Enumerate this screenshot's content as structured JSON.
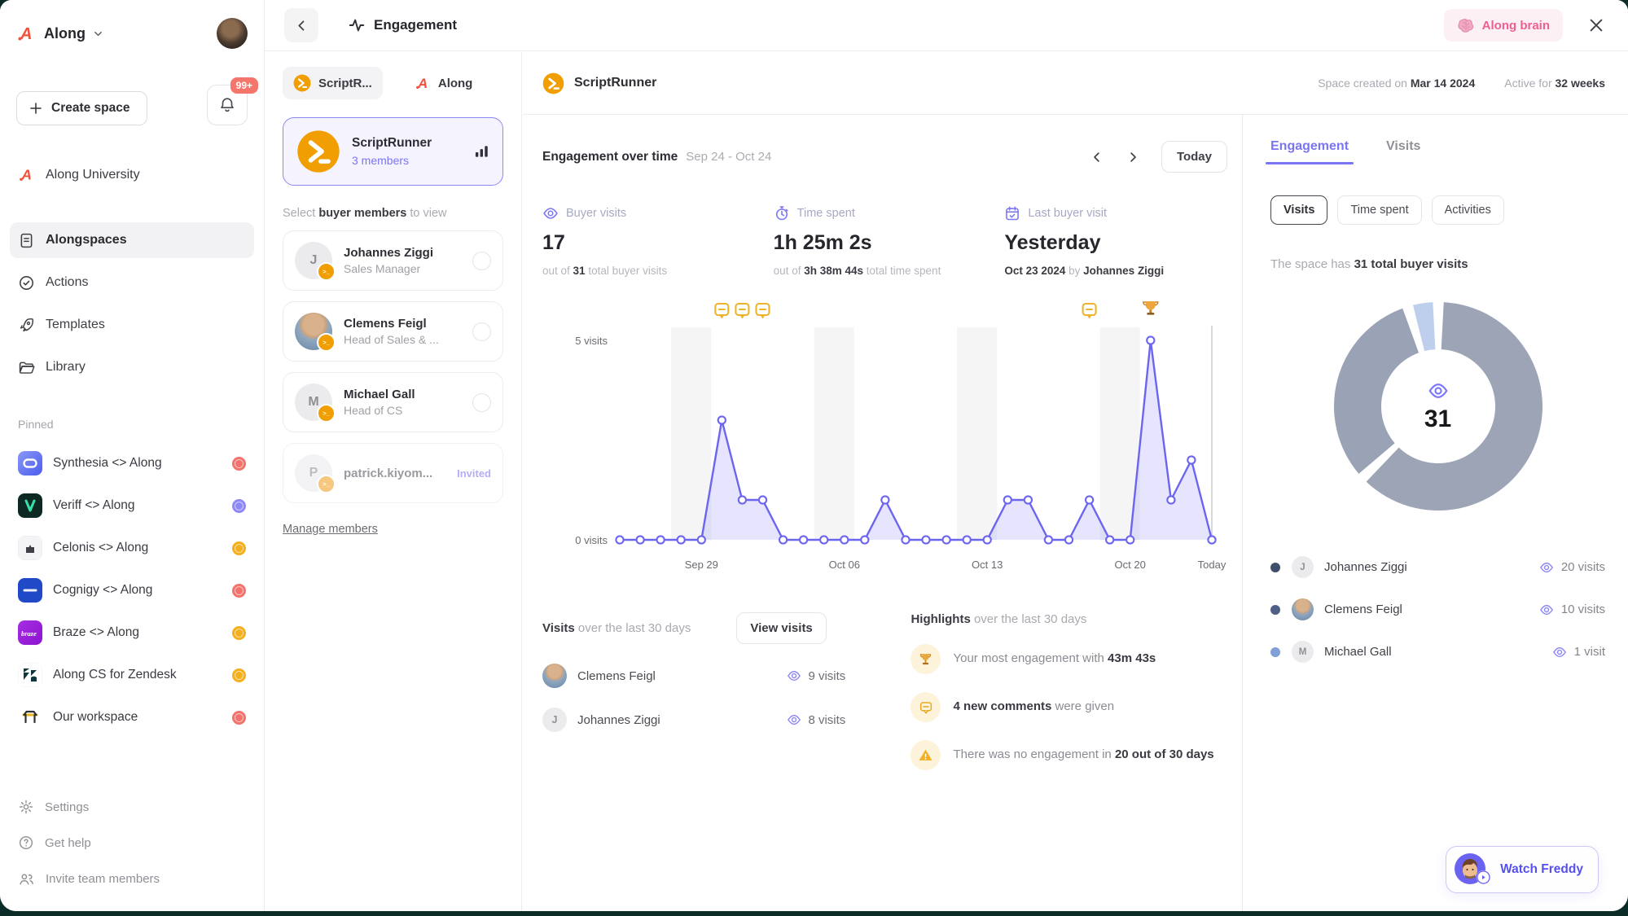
{
  "colors": {
    "accent_purple": "#7b74f3",
    "chart_line": "#6b65ef",
    "brand_red": "#f4503a",
    "orange": "#f19e02",
    "pink": "#ee5f93",
    "yellow": "#f3b01c"
  },
  "sidebar": {
    "workspace_name": "Along",
    "create_space_label": "Create space",
    "notification_badge": "99+",
    "university_label": "Along University",
    "nav_items": [
      {
        "label": "Alongspaces",
        "icon": "doc",
        "active": true
      },
      {
        "label": "Actions",
        "icon": "check-circle",
        "active": false
      },
      {
        "label": "Templates",
        "icon": "rocket",
        "active": false
      },
      {
        "label": "Library",
        "icon": "folder",
        "active": false
      }
    ],
    "pinned_label": "Pinned",
    "pinned_items": [
      {
        "label": "Synthesia <> Along",
        "icon": "synthesia",
        "status": "red"
      },
      {
        "label": "Veriff <> Along",
        "icon": "veriff",
        "status": "purple"
      },
      {
        "label": "Celonis <> Along",
        "icon": "celonis",
        "status": "yellow"
      },
      {
        "label": "Cognigy <> Along",
        "icon": "cognigy",
        "status": "red"
      },
      {
        "label": "Braze <> Along",
        "icon": "braze",
        "status": "yellow"
      },
      {
        "label": "Along CS for Zendesk",
        "icon": "zendesk",
        "status": "yellow"
      },
      {
        "label": "Our workspace",
        "icon": "workspace",
        "status": "red"
      }
    ],
    "footer_items": [
      {
        "label": "Settings",
        "icon": "gear"
      },
      {
        "label": "Get help",
        "icon": "help"
      },
      {
        "label": "Invite team members",
        "icon": "users"
      }
    ]
  },
  "topbar": {
    "title": "Engagement",
    "brain_button": "Along brain"
  },
  "space_panel": {
    "tabs": [
      {
        "label": "ScriptR...",
        "active": true
      },
      {
        "label": "Along",
        "active": false
      }
    ],
    "space_card": {
      "name": "ScriptRunner",
      "members": "3 members"
    },
    "select_hint": [
      {
        "t": "g",
        "s": "Select "
      },
      {
        "t": "b",
        "s": "buyer members"
      },
      {
        "t": "g",
        "s": " to view"
      }
    ],
    "members": [
      {
        "name": "Johannes Ziggi",
        "role": "Sales Manager",
        "avatar": "J",
        "invited": false
      },
      {
        "name": "Clemens Feigl",
        "role": "Head of Sales & ...",
        "avatar": "photo",
        "invited": false
      },
      {
        "name": "Michael Gall",
        "role": "Head of CS",
        "avatar": "M",
        "invited": false
      },
      {
        "name": "patrick.kiyom...",
        "role": "",
        "avatar": "P",
        "invited": true,
        "invited_label": "Invited"
      }
    ],
    "manage_link": "Manage members"
  },
  "main": {
    "space_name": "ScriptRunner",
    "created": [
      {
        "t": "g",
        "s": "Space created on "
      },
      {
        "t": "b",
        "s": "Mar 14 2024"
      }
    ],
    "active": [
      {
        "t": "g",
        "s": "Active for "
      },
      {
        "t": "b",
        "s": "32 weeks"
      }
    ],
    "section_title": "Engagement over time",
    "date_range": "Sep 24 - Oct 24",
    "today_button": "Today",
    "kpis": [
      {
        "icon": "eye",
        "label": "Buyer visits",
        "value": "17",
        "sub": [
          {
            "t": "g",
            "s": "out of "
          },
          {
            "t": "b",
            "s": "31"
          },
          {
            "t": "g",
            "s": " total buyer visits"
          }
        ]
      },
      {
        "icon": "stopwatch",
        "label": "Time spent",
        "value": "1h 25m 2s",
        "sub": [
          {
            "t": "g",
            "s": "out of "
          },
          {
            "t": "b",
            "s": "3h 38m 44s"
          },
          {
            "t": "g",
            "s": " total time spent"
          }
        ]
      },
      {
        "icon": "calendar",
        "label": "Last buyer visit",
        "value": "Yesterday",
        "sub": [
          {
            "t": "b",
            "s": "Oct 23 2024"
          },
          {
            "t": "g",
            "s": " by "
          },
          {
            "t": "b",
            "s": "Johannes Ziggi"
          }
        ]
      }
    ],
    "visits_section": {
      "title": [
        {
          "t": "b",
          "s": "Visits"
        },
        {
          "t": "g",
          "s": " over the last 30 days"
        }
      ],
      "button": "View visits",
      "rows": [
        {
          "name": "Clemens Feigl",
          "avatar": "photo",
          "count": "9 visits"
        },
        {
          "name": "Johannes Ziggi",
          "avatar": "J",
          "count": "8 visits"
        }
      ]
    },
    "highlights_section": {
      "title": [
        {
          "t": "b",
          "s": "Highlights"
        },
        {
          "t": "g",
          "s": " over the last 30 days"
        }
      ],
      "rows": [
        {
          "icon": "trophy",
          "text": [
            {
              "t": "g",
              "s": "Your most engagement with "
            },
            {
              "t": "b",
              "s": "43m 43s"
            }
          ]
        },
        {
          "icon": "comment",
          "text": [
            {
              "t": "b",
              "s": "4 new comments"
            },
            {
              "t": "g",
              "s": " were given"
            }
          ]
        },
        {
          "icon": "warning",
          "text": [
            {
              "t": "g",
              "s": "There was no engagement in "
            },
            {
              "t": "b",
              "s": "20 out of 30 days"
            }
          ]
        }
      ]
    }
  },
  "right_panel": {
    "tabs": [
      {
        "label": "Engagement",
        "active": true
      },
      {
        "label": "Visits",
        "active": false
      }
    ],
    "pills": [
      {
        "label": "Visits",
        "active": true
      },
      {
        "label": "Time spent",
        "active": false
      },
      {
        "label": "Activities",
        "active": false
      }
    ],
    "summary": [
      {
        "t": "g",
        "s": "The space has "
      },
      {
        "t": "b",
        "s": "31 total buyer visits"
      }
    ],
    "donut_total": "31",
    "legend": [
      {
        "name": "Johannes Ziggi",
        "avatar": "J",
        "count": "20 visits",
        "dot": "#3f4e6b"
      },
      {
        "name": "Clemens Feigl",
        "avatar": "photo",
        "count": "10 visits",
        "dot": "#4f5f85"
      },
      {
        "name": "Michael Gall",
        "avatar": "M",
        "count": "1 visit",
        "dot": "#81a0d8"
      }
    ],
    "watch_button": "Watch Freddy"
  },
  "chart_data": [
    {
      "type": "area",
      "title": "Engagement over time",
      "x": [
        "Sep 25",
        "Sep 26",
        "Sep 27",
        "Sep 28",
        "Sep 29",
        "Sep 30",
        "Oct 01",
        "Oct 02",
        "Oct 03",
        "Oct 04",
        "Oct 05",
        "Oct 06",
        "Oct 07",
        "Oct 08",
        "Oct 09",
        "Oct 10",
        "Oct 11",
        "Oct 12",
        "Oct 13",
        "Oct 14",
        "Oct 15",
        "Oct 16",
        "Oct 17",
        "Oct 18",
        "Oct 19",
        "Oct 20",
        "Oct 21",
        "Oct 22",
        "Oct 23",
        "Oct 24"
      ],
      "values": [
        0,
        0,
        0,
        0,
        0,
        3,
        1,
        1,
        0,
        0,
        0,
        0,
        0,
        1,
        0,
        0,
        0,
        0,
        0,
        1,
        1,
        0,
        0,
        1,
        0,
        0,
        5,
        1,
        2,
        0
      ],
      "ylim": [
        0,
        5
      ],
      "yticks": [
        "0 visits",
        "5 visits"
      ],
      "xticks": [
        {
          "index": 4,
          "label": "Sep 29"
        },
        {
          "index": 11,
          "label": "Oct 06"
        },
        {
          "index": 18,
          "label": "Oct 13"
        },
        {
          "index": 25,
          "label": "Oct 20"
        },
        {
          "index": 29,
          "label": "Today"
        }
      ],
      "weekend_bands": [
        [
          3,
          4
        ],
        [
          10,
          11
        ],
        [
          17,
          18
        ],
        [
          24,
          25
        ]
      ],
      "annotations": [
        {
          "index": 5,
          "type": "comment"
        },
        {
          "index": 6,
          "type": "comment"
        },
        {
          "index": 7,
          "type": "comment"
        },
        {
          "index": 23,
          "type": "comment"
        },
        {
          "index": 26,
          "type": "trophy"
        }
      ],
      "today_index": 29,
      "line_color": "#6b65ef",
      "fill_color": "#8f8af4",
      "grid": false,
      "legend_position": "none"
    },
    {
      "type": "donut",
      "title": "Total buyer visits",
      "total": 31,
      "segments": [
        {
          "name": "Johannes Ziggi",
          "value": 20,
          "color": "#9ca4b5"
        },
        {
          "name": "Clemens Feigl",
          "value": 10,
          "color": "#9aa2b6"
        },
        {
          "name": "Michael Gall",
          "value": 1,
          "color": "#bdcfec"
        }
      ]
    }
  ]
}
